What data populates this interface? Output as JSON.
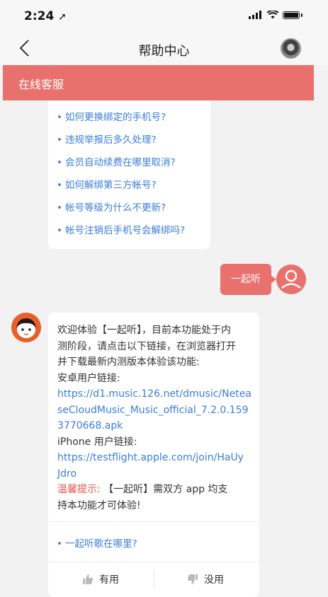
{
  "status_bar": {
    "time": "2:24",
    "location_glyph": "➚"
  },
  "nav": {
    "title": "帮助中心"
  },
  "banner": {
    "label": "在线客服"
  },
  "questions": [
    "如何更换绑定的手机号?",
    "违规举报后多久处理?",
    "会员自动续费在哪里取消?",
    "如何解绑第三方帐号?",
    "帐号等级为什么不更新?",
    "帐号注销后手机号会解绑吗?"
  ],
  "user_message": "一起听",
  "answer": {
    "lines": [
      "欢迎体验【一起听】，目前本功能处于内",
      "测阶段，请点击以下链接，在浏览器打开",
      "并下载最新内测版本体验该功能:",
      "安卓用户链接:"
    ],
    "android_link_lines": [
      "https://d1.music.126.net/dmusic/Netea",
      "seCloudMusic_Music_official_7.2.0.159",
      "3770668.apk"
    ],
    "iphone_label": "iPhone 用户链接:",
    "iphone_link_lines": [
      "https://testflight.apple.com/join/HaUy",
      "Jdro"
    ],
    "tip_label": "温馨提示:",
    "tip_line1": " 【一起听】需双方 app 均支",
    "tip_line2": "持本功能才可体验!"
  },
  "related_question": "一起听歌在哪里?",
  "feedback": {
    "useful": "有用",
    "useless": "没用"
  },
  "colors": {
    "accent": "#e8716d",
    "link": "#3b7dd8",
    "warning": "#e8534e"
  }
}
